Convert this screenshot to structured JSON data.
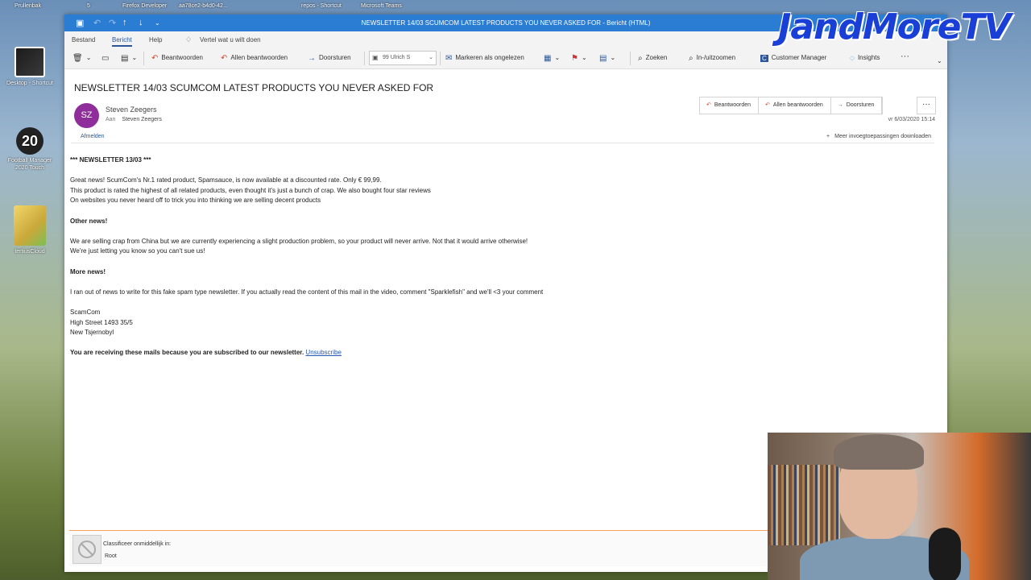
{
  "desktop": {
    "top_items": [
      "Prullenbak",
      "5",
      "Firefox Developer",
      "aa78ce2-b4d0-42...",
      "repos - Shortcut",
      "Microsoft Teams"
    ],
    "icons": [
      {
        "label": "Desktop - Shortcut",
        "icon": "shortcut-icon"
      },
      {
        "label": "Football Manager 2020 Touch",
        "badge": "20",
        "icon": "game-icon"
      },
      {
        "label": "tertiusCloud",
        "icon": "folder-icon"
      }
    ]
  },
  "brand": {
    "text": "JandMoreTV",
    "color": "#1a3fd6"
  },
  "window": {
    "title": "NEWSLETTER 14/03 SCUMCOM LATEST PRODUCTS YOU NEVER ASKED FOR  -  Bericht (HTML)",
    "accent": "#2b7cd3"
  },
  "menu": {
    "bestand": "Bestand",
    "bericht": "Bericht",
    "help": "Help",
    "tell_me": "Vertel wat u wilt doen"
  },
  "ribbon": {
    "beantwoorden": "Beantwoorden",
    "allen_beantwoorden": "Allen beantwoorden",
    "doorsturen": "Doorsturen",
    "quickstep": "99 Ulrich S",
    "markeren": "Markeren als ongelezen",
    "zoeken": "Zoeken",
    "zoom": "In-/uitzoomen",
    "customer_manager": "Customer Manager",
    "insights": "Insights",
    "more": "···"
  },
  "message": {
    "subject": "NEWSLETTER 14/03 SCUMCOM LATEST PRODUCTS YOU NEVER ASKED FOR",
    "avatar_initials": "SZ",
    "avatar_color": "#8f2e9a",
    "sender": "Steven Zeegers",
    "to_label": "Aan",
    "to": "Steven Zeegers",
    "datetime": "vr 6/03/2020 15:14",
    "afmelden": "Afmelden",
    "addins": "Meer invoegtoepassingen downloaden",
    "actions": {
      "reply": "Beantwoorden",
      "reply_all": "Allen beantwoorden",
      "forward": "Doorsturen",
      "more": "···"
    }
  },
  "body": {
    "heading": "*** NEWSLETTER 13/03 ***",
    "p1": [
      "Great news! ScumCom's Nr.1 rated product, Spamsauce, is now available at a discounted rate. Only € 99,99.",
      "This product is rated the highest of all related products, even thought it's just a bunch of crap. We also bought four star reviews",
      "On websites you never heard off to trick you into thinking we are selling decent products"
    ],
    "h2": "Other news!",
    "p2": [
      "We are selling crap from China but we are currently experiencing a slight production problem, so your product will never arrive. Not that it would arrive otherwise!",
      "We're just letting you know so you can't sue us!"
    ],
    "h3": "More news!",
    "p3": "I ran out of news to write for this fake spam type newsletter. If you actually read the content of this mail in the video, comment \"Sparklefish\" and we'll <3 your comment",
    "address": [
      "ScamCom",
      "High Street 1493 35/5",
      "New Tsjernobyl"
    ],
    "footer": "You are receiving these mails because you are subscribed to our newsletter.",
    "unsubscribe": "Unsubscribe"
  },
  "classify": {
    "label": "Classificeer onmiddellijk in:",
    "value": "Root"
  }
}
